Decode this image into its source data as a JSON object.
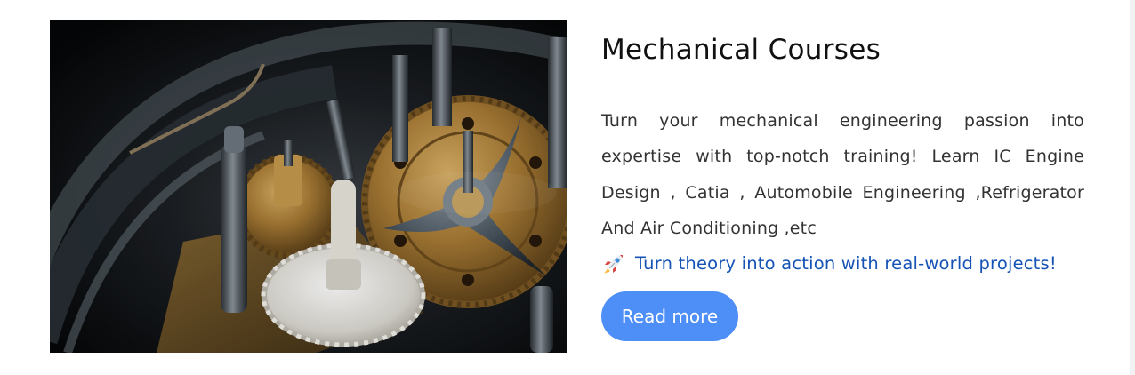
{
  "course": {
    "title": "Mechanical Courses",
    "description": "Turn your mechanical engineering passion into expertise with top-notch training! Learn IC Engine Design , Catia , Automobile Engineering ,Refrigerator And Air Conditioning ,etc",
    "highlight_text": "Turn theory into action with real-world projects!",
    "highlight_icon": "rocket-icon",
    "button_label": "Read more",
    "image_subject": "gear-mechanism-photo"
  },
  "colors": {
    "title": "#111111",
    "text": "#333333",
    "highlight": "#1553b5",
    "button": "#4e8ef7",
    "button_text": "#ffffff"
  }
}
